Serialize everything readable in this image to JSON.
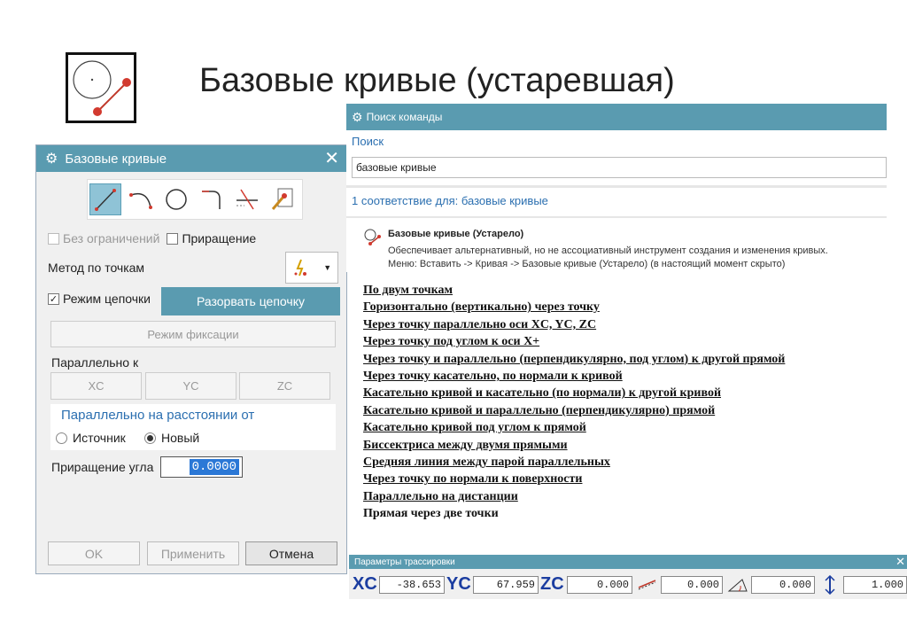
{
  "slide": {
    "title": "Базовые кривые (устаревшая)",
    "icon": "basic-curves-icon"
  },
  "dialog": {
    "title": "Базовые кривые",
    "close": "✕",
    "curve_types": [
      "line-icon",
      "arc-icon",
      "circle-icon",
      "fillet-icon",
      "trim-icon",
      "edit-params-icon"
    ],
    "unbounded_label": "Без ограничений",
    "increment_label": "Приращение",
    "point_method_label": "Метод по точкам",
    "chain_mode_label": "Режим цепочки",
    "break_chain_label": "Разорвать цепочку",
    "lock_mode_label": "Режим фиксации",
    "parallel_to_label": "Параллельно к",
    "axes": [
      "XC",
      "YC",
      "ZC"
    ],
    "parallel_distance_title": "Параллельно на расстоянии от",
    "source_label": "Источник",
    "new_label": "Новый",
    "angle_increment_label": "Приращение угла",
    "angle_increment_value": "0.0000",
    "ok_label": "OK",
    "apply_label": "Применить",
    "cancel_label": "Отмена"
  },
  "search": {
    "title": "Поиск команды",
    "search_label": "Поиск",
    "query": "базовые кривые",
    "matches": "1 соответствие для: базовые кривые",
    "result_title": "Базовые кривые (Устарело)",
    "result_desc": "Обеспечивает альтернативный, но не ассоциативный инструмент создания и изменения кривых.",
    "result_menu": "Меню: Вставить -> Кривая -> Базовые кривые (Устарело) (в настоящий момент скрыто)"
  },
  "methods": [
    "По двум точкам",
    "Горизонтально (вертикально) через точку",
    "Через точку параллельно оси XC, YC, ZC",
    "Через точку под углом к оси X+",
    "Через точку и параллельно (перпендикулярно, под углом) к другой прямой",
    "Через точку касательно, по нормали к кривой",
    "Касательно кривой и касательно (по нормали) к другой кривой",
    "Касательно кривой и параллельно (перпендикулярно) прямой",
    "Касательно кривой под углом к прямой",
    "Биссектриса между двумя прямыми",
    "Средняя линия между парой параллельных",
    "Через точку по нормали к поверхности",
    "Параллельно на дистанции",
    "Прямая через две точки"
  ],
  "tracking": {
    "title": "Параметры трассировки",
    "close": "✕",
    "xc_label": "XC",
    "yc_label": "YC",
    "zc_label": "ZC",
    "xc": "-38.653",
    "yc": "67.959",
    "zc": "0.000",
    "length": "0.000",
    "angle": "0.000",
    "offset": "1.000"
  }
}
